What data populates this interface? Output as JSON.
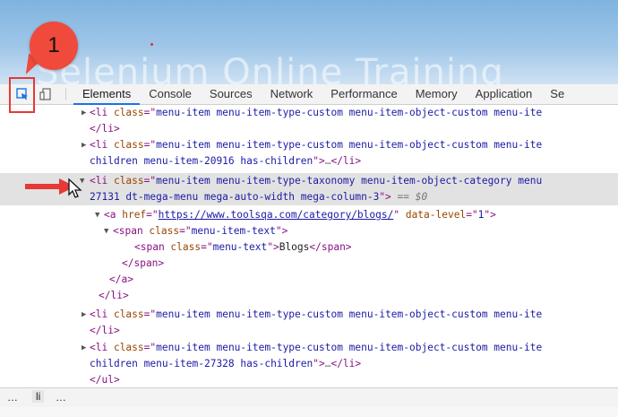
{
  "webpage": {
    "ghost_title": "Selenium Online Training"
  },
  "annotation": {
    "step_number": "1"
  },
  "devtools": {
    "tabs": [
      {
        "label": "Elements",
        "active": true
      },
      {
        "label": "Console"
      },
      {
        "label": "Sources"
      },
      {
        "label": "Network"
      },
      {
        "label": "Performance"
      },
      {
        "label": "Memory"
      },
      {
        "label": "Application"
      },
      {
        "label": "Se"
      }
    ],
    "lines": [
      {
        "tri": "▶",
        "parts": [
          [
            "tag",
            "<li "
          ],
          [
            "attr",
            "class"
          ],
          [
            "tag",
            "=\""
          ],
          [
            "val",
            "menu-item menu-item-type-custom menu-item-object-custom menu-ite"
          ]
        ]
      },
      {
        "parts": [
          [
            "tag",
            "</li>"
          ]
        ]
      },
      {
        "tri": "▶",
        "parts": [
          [
            "tag",
            "<li "
          ],
          [
            "attr",
            "class"
          ],
          [
            "tag",
            "=\""
          ],
          [
            "val",
            "menu-item menu-item-type-custom menu-item-object-custom menu-ite"
          ]
        ]
      },
      {
        "parts": [
          [
            "val",
            "children menu-item-20916 has-children"
          ],
          [
            "tag",
            "\">"
          ],
          [
            "dots",
            "…"
          ],
          [
            "tag",
            "</li>"
          ]
        ]
      },
      {
        "tri": "▼",
        "parts": [
          [
            "tag",
            "<li "
          ],
          [
            "attr",
            "class"
          ],
          [
            "tag",
            "=\""
          ],
          [
            "val",
            "menu-item menu-item-type-taxonomy menu-item-object-category menu"
          ]
        ]
      },
      {
        "parts": [
          [
            "val",
            "27131 dt-mega-menu mega-auto-width mega-column-3"
          ],
          [
            "tag",
            "\">"
          ],
          [
            "eq",
            " == $0"
          ]
        ]
      },
      {
        "tri": "▼",
        "parts": [
          [
            "tag",
            "<a "
          ],
          [
            "attr",
            "href"
          ],
          [
            "tag",
            "=\""
          ],
          [
            "link",
            "https://www.toolsqa.com/category/blogs/"
          ],
          [
            "tag",
            "\" "
          ],
          [
            "attr",
            "data-level"
          ],
          [
            "tag",
            "=\""
          ],
          [
            "val",
            "1"
          ],
          [
            "tag",
            "\">"
          ]
        ]
      },
      {
        "tri": "▼",
        "parts": [
          [
            "tag",
            "<span "
          ],
          [
            "attr",
            "class"
          ],
          [
            "tag",
            "=\""
          ],
          [
            "val",
            "menu-item-text"
          ],
          [
            "tag",
            "\">"
          ]
        ]
      },
      {
        "parts": [
          [
            "tag",
            "<span "
          ],
          [
            "attr",
            "class"
          ],
          [
            "tag",
            "=\""
          ],
          [
            "val",
            "menu-text"
          ],
          [
            "tag",
            "\">"
          ],
          [
            "txt",
            "Blogs"
          ],
          [
            "tag",
            "</span>"
          ]
        ]
      },
      {
        "parts": [
          [
            "tag",
            "</span>"
          ]
        ]
      },
      {
        "parts": [
          [
            "tag",
            "</a>"
          ]
        ]
      },
      {
        "parts": [
          [
            "tag",
            "</li>"
          ]
        ]
      },
      {
        "tri": "▶",
        "parts": [
          [
            "tag",
            "<li "
          ],
          [
            "attr",
            "class"
          ],
          [
            "tag",
            "=\""
          ],
          [
            "val",
            "menu-item menu-item-type-custom menu-item-object-custom menu-ite"
          ]
        ]
      },
      {
        "parts": [
          [
            "tag",
            "</li>"
          ]
        ]
      },
      {
        "tri": "▶",
        "parts": [
          [
            "tag",
            "<li "
          ],
          [
            "attr",
            "class"
          ],
          [
            "tag",
            "=\""
          ],
          [
            "val",
            "menu-item menu-item-type-custom menu-item-object-custom menu-ite"
          ]
        ]
      },
      {
        "parts": [
          [
            "val",
            "children menu-item-27328 has-children"
          ],
          [
            "tag",
            "\">"
          ],
          [
            "dots",
            "…"
          ],
          [
            "tag",
            "</li>"
          ]
        ]
      },
      {
        "parts": [
          [
            "tag",
            "</ul>"
          ]
        ]
      }
    ],
    "gutter_dots": "…",
    "breadcrumb": {
      "prefix": "…",
      "item": "li",
      "suffix": "…"
    }
  },
  "colors": {
    "annotation_red": "#ef4a3c",
    "active_tab_underline": "#1a73e8",
    "selected_row": "#e2e2e2"
  }
}
